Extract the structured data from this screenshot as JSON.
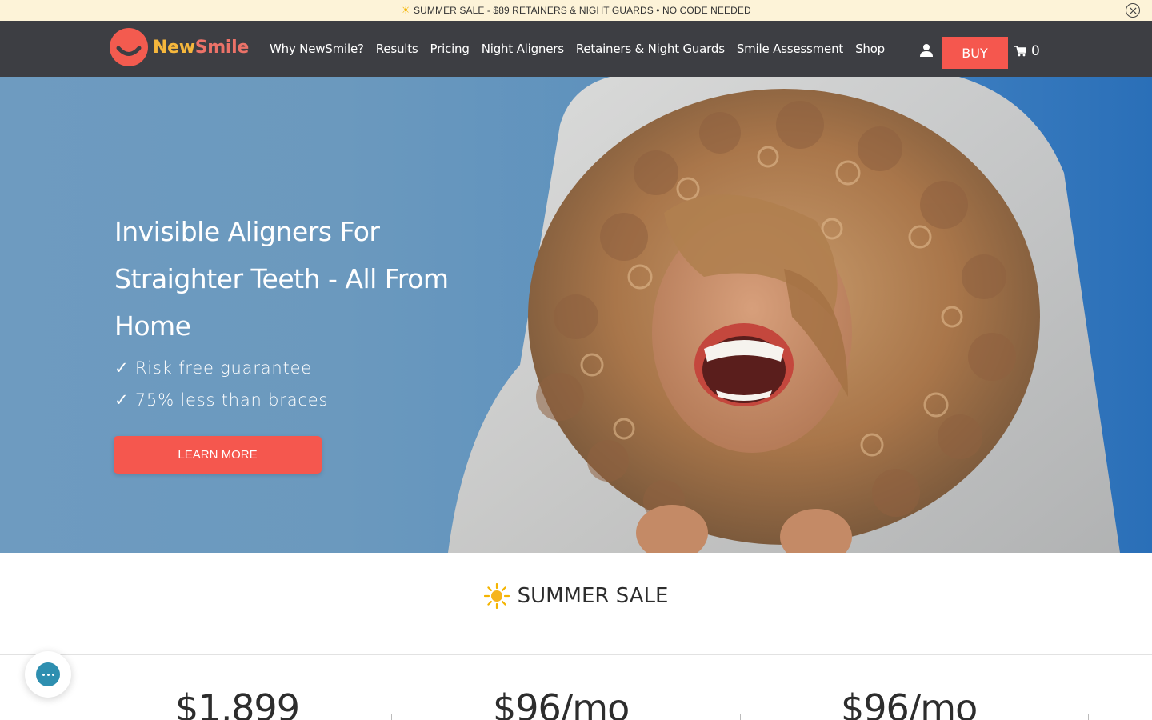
{
  "announcement": {
    "icon": "sun-icon",
    "text": "SUMMER SALE - $89 RETAINERS & NIGHT GUARDS • NO CODE NEEDED",
    "close_icon": "close-circle-icon"
  },
  "header": {
    "logo": {
      "part1": "New",
      "part2": "Smile"
    },
    "nav": [
      {
        "label": "Why NewSmile?"
      },
      {
        "label": "Results"
      },
      {
        "label": "Pricing"
      },
      {
        "label": "Night Aligners"
      },
      {
        "label": "Retainers & Night Guards"
      },
      {
        "label": "Smile Assessment"
      },
      {
        "label": "Shop"
      }
    ],
    "account_icon": "user-icon",
    "buy_label": "BUY",
    "cart_icon": "cart-icon",
    "cart_count": "0"
  },
  "hero": {
    "title": "Invisible Aligners For Straighter Teeth - All From Home",
    "checks": [
      "✓ Risk free guarantee",
      "✓ 75% less than braces"
    ],
    "cta_label": "LEARN MORE"
  },
  "sale": {
    "icon": "sun-icon",
    "heading": "SUMMER SALE"
  },
  "prices": [
    {
      "value": "$1,899"
    },
    {
      "value": "$96/mo"
    },
    {
      "value": "$96/mo"
    }
  ],
  "colors": {
    "accent": "#f5574e",
    "header_bg": "#3d3e43",
    "announcement_bg": "#fdf3d8",
    "logo_new": "#f6b73c",
    "logo_smile": "#ec7268"
  },
  "chat": {
    "icon": "chat-icon"
  }
}
